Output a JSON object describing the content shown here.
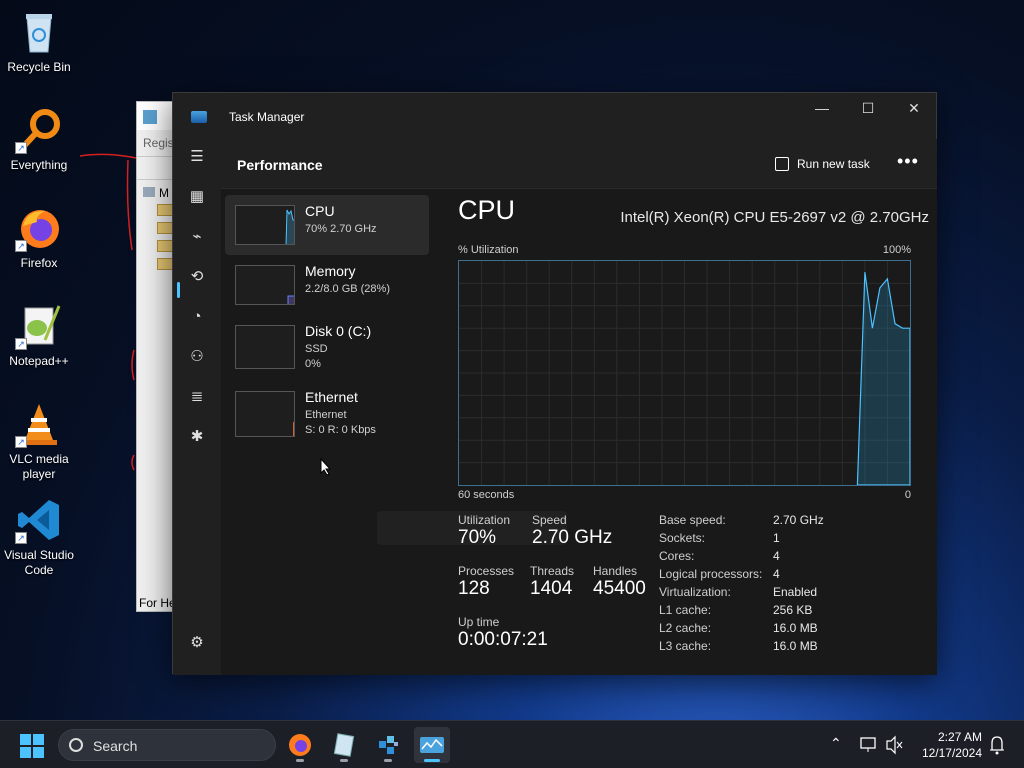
{
  "desktop": {
    "icons": [
      {
        "label": "Recycle Bin",
        "icon": "recycle-bin-icon"
      },
      {
        "label": "Everything",
        "icon": "everything-search-icon"
      },
      {
        "label": "Firefox",
        "icon": "firefox-icon"
      },
      {
        "label": "Notepad++",
        "icon": "notepad-plus-plus-icon"
      },
      {
        "label": "VLC media player",
        "icon": "vlc-icon"
      },
      {
        "label": "Visual Studio Code",
        "icon": "vscode-icon"
      }
    ],
    "background_window": {
      "menu_fragment": "Regis",
      "tree_root_fragment": "M",
      "status_fragment": "For He"
    }
  },
  "task_manager": {
    "window_title": "Task Manager",
    "page_title": "Performance",
    "run_new_task_label": "Run new task",
    "more_label": "•••",
    "sidebar_items": [
      {
        "name": "CPU",
        "line1": "70%  2.70 GHz",
        "line2": ""
      },
      {
        "name": "Memory",
        "line1": "2.2/8.0 GB (28%)",
        "line2": ""
      },
      {
        "name": "Disk 0 (C:)",
        "line1": "SSD",
        "line2": "0%"
      },
      {
        "name": "Ethernet",
        "line1": "Ethernet",
        "line2": "S: 0 R: 0 Kbps"
      }
    ],
    "cpu": {
      "title": "CPU",
      "model": "Intel(R) Xeon(R) CPU E5-2697 v2 @ 2.70GHz",
      "graph_top_left": "% Utilization",
      "graph_top_right": "100%",
      "graph_bottom_left": "60 seconds",
      "graph_bottom_right": "0",
      "utilization_label": "Utilization",
      "utilization_value": "70%",
      "speed_label": "Speed",
      "speed_value": "2.70 GHz",
      "processes_label": "Processes",
      "processes_value": "128",
      "threads_label": "Threads",
      "threads_value": "1404",
      "handles_label": "Handles",
      "handles_value": "45400",
      "uptime_label": "Up time",
      "uptime_value": "0:00:07:21",
      "specs": [
        {
          "k": "Base speed:",
          "v": "2.70 GHz"
        },
        {
          "k": "Sockets:",
          "v": "1"
        },
        {
          "k": "Cores:",
          "v": "4"
        },
        {
          "k": "Logical processors:",
          "v": "4"
        },
        {
          "k": "Virtualization:",
          "v": "Enabled"
        },
        {
          "k": "L1 cache:",
          "v": "256 KB"
        },
        {
          "k": "L2 cache:",
          "v": "16.0 MB"
        },
        {
          "k": "L3 cache:",
          "v": "16.0 MB"
        }
      ],
      "utilization_history_pct": [
        0,
        0,
        0,
        0,
        0,
        0,
        0,
        0,
        0,
        0,
        0,
        0,
        0,
        0,
        0,
        0,
        0,
        0,
        0,
        0,
        0,
        0,
        0,
        0,
        0,
        0,
        0,
        0,
        0,
        0,
        0,
        0,
        0,
        0,
        0,
        0,
        0,
        0,
        0,
        0,
        0,
        0,
        0,
        0,
        0,
        0,
        0,
        0,
        0,
        0,
        0,
        0,
        0,
        0,
        95,
        70,
        88,
        92,
        72,
        70,
        70
      ]
    },
    "accent_color": "#4cc2ff"
  },
  "taskbar": {
    "search_placeholder": "Search",
    "apps": [
      "firefox-icon",
      "notepad-icon",
      "regedit-icon",
      "task-manager-icon"
    ],
    "time": "2:27 AM",
    "date": "12/17/2024"
  }
}
